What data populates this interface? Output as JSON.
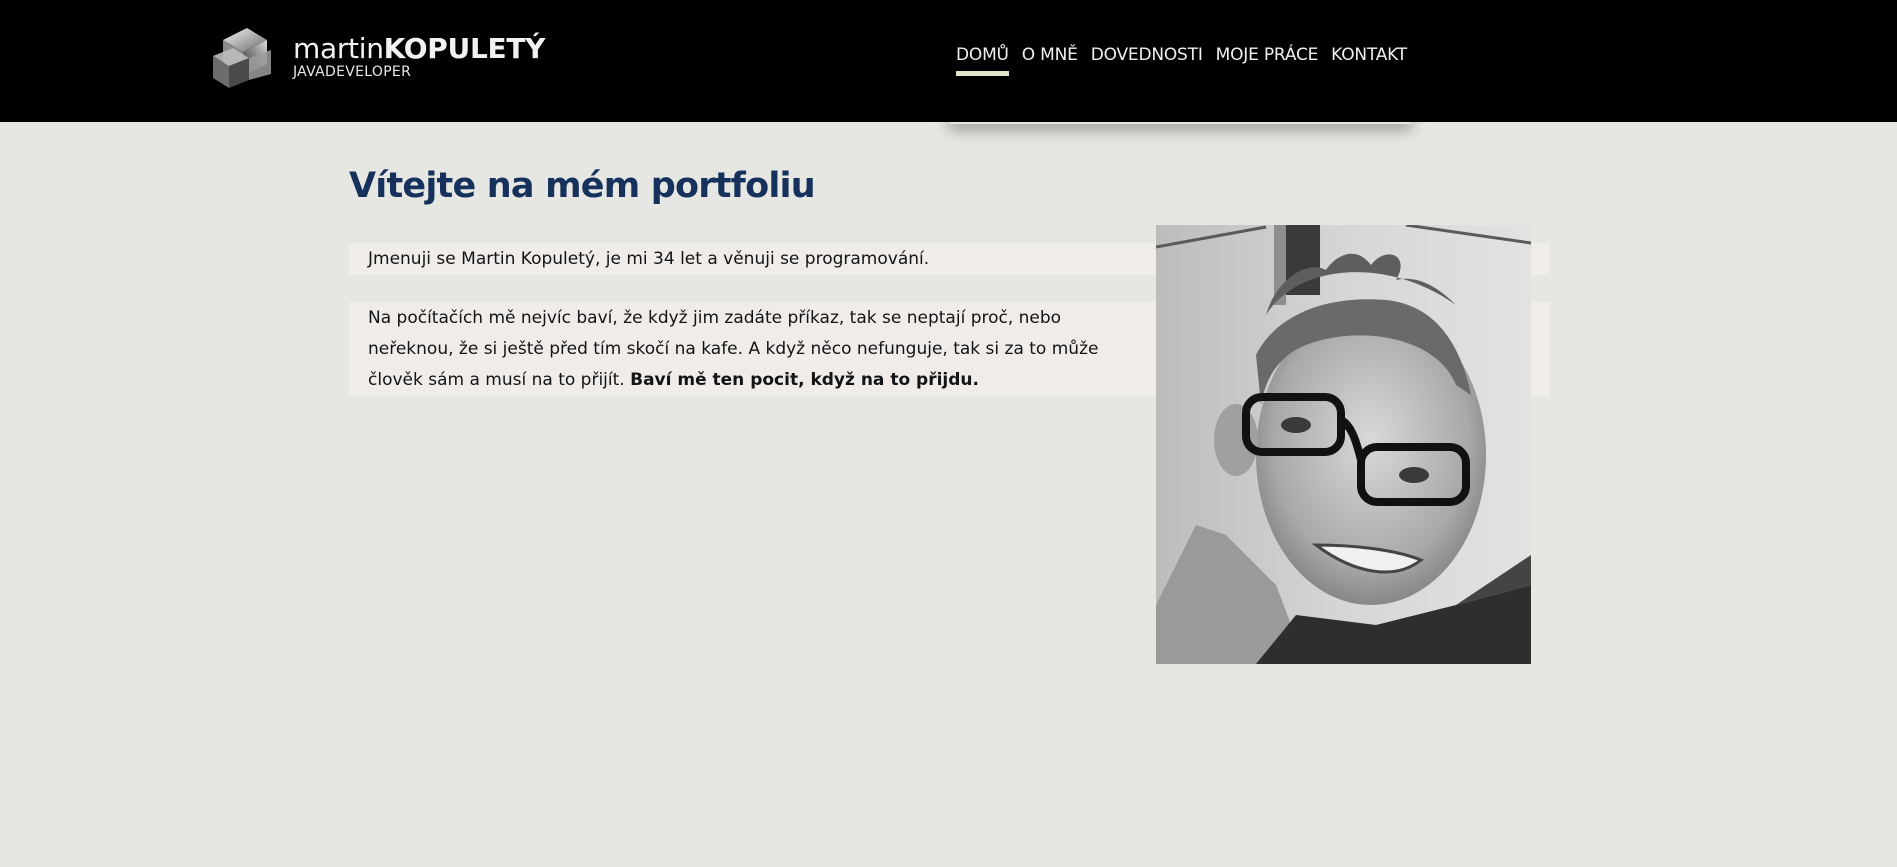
{
  "header": {
    "logo": {
      "icon": "cube-logo-icon",
      "name_first": "martin",
      "name_last": "KOPULETÝ",
      "subtitle": "JAVADEVELOPER"
    },
    "nav": [
      {
        "label": "DOMŮ",
        "active": true
      },
      {
        "label": "O MNĚ",
        "active": false
      },
      {
        "label": "DOVEDNOSTI",
        "active": false
      },
      {
        "label": "MOJE PRÁCE",
        "active": false
      },
      {
        "label": "KONTAKT",
        "active": false
      }
    ]
  },
  "main": {
    "title": "Vítejte na mém portfoliu",
    "intro": "Jmenuji se Martin Kopuletý, je mi 34 let a věnuji se programování.",
    "para2_text": "Na počítačích mě nejvíc baví, že když jim zadáte příkaz, tak se neptají proč, nebo neřeknou, že si ještě před tím skočí na kafe. A když něco nefunguje, tak si za to může člověk sám a musí na to přijít.",
    "para2_bold": "Baví mě ten pocit, když na to přijdu."
  },
  "colors": {
    "header_bg": "#000000",
    "page_bg": "#e6e6e2",
    "title": "#15315c",
    "nav_active_underline": "#dfe6c8",
    "para_bg": "#efecea"
  }
}
